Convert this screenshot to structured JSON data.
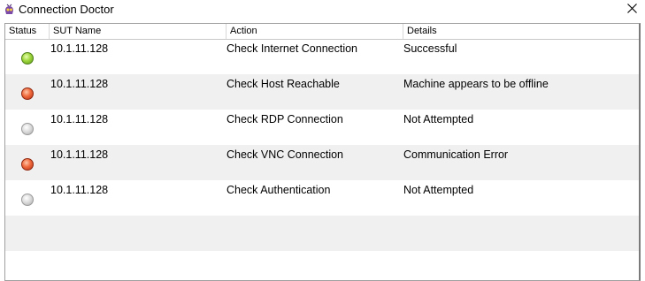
{
  "window": {
    "title": "Connection Doctor"
  },
  "table": {
    "columns": [
      "Status",
      "SUT Name",
      "Action",
      "Details"
    ],
    "rows": [
      {
        "status": "green",
        "sut_name": "10.1.11.128",
        "action": "Check Internet Connection",
        "details": "Successful"
      },
      {
        "status": "red",
        "sut_name": "10.1.11.128",
        "action": "Check Host Reachable",
        "details": "Machine appears to be offline"
      },
      {
        "status": "grey",
        "sut_name": "10.1.11.128",
        "action": "Check RDP Connection",
        "details": "Not Attempted"
      },
      {
        "status": "red",
        "sut_name": "10.1.11.128",
        "action": "Check VNC Connection",
        "details": "Communication Error"
      },
      {
        "status": "grey",
        "sut_name": "10.1.11.128",
        "action": "Check Authentication",
        "details": "Not Attempted"
      }
    ]
  },
  "colors": {
    "status_ok": "#8fcf35",
    "status_error": "#e8552a",
    "status_pending": "#cfcfcf"
  }
}
